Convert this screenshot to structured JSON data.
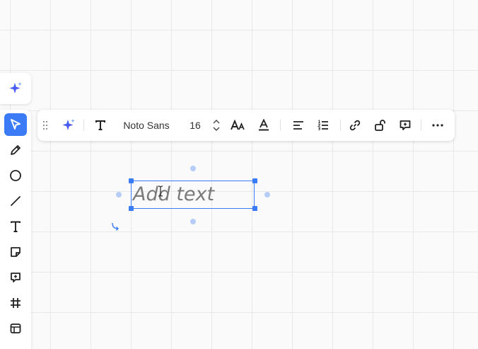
{
  "colors": {
    "accent": "#3b7cf6",
    "connector": "#b5cdf7",
    "canvas": "#fafafa",
    "grid": "#e8e8e8"
  },
  "ai_button": {
    "icon": "sparkle-icon"
  },
  "left_toolbar": {
    "tools": [
      {
        "name": "select",
        "icon": "cursor-icon",
        "active": true
      },
      {
        "name": "pen",
        "icon": "pen-icon"
      },
      {
        "name": "shape",
        "icon": "circle-icon"
      },
      {
        "name": "line",
        "icon": "line-icon"
      },
      {
        "name": "text",
        "icon": "text-icon"
      },
      {
        "name": "sticky-note",
        "icon": "sticky-note-icon"
      },
      {
        "name": "comment",
        "icon": "comment-icon"
      },
      {
        "name": "frame",
        "icon": "frame-icon"
      },
      {
        "name": "template",
        "icon": "template-icon"
      }
    ]
  },
  "context_toolbar": {
    "font_family": "Noto Sans",
    "font_size": "16",
    "items": [
      "drag-handle-icon",
      "sparkle-icon",
      "text-style-icon",
      "font-size-toggle-icon",
      "text-color-icon",
      "align-left-icon",
      "list-icon",
      "link-icon",
      "lock-icon",
      "add-comment-icon",
      "more-icon"
    ]
  },
  "canvas": {
    "text_box": {
      "placeholder": "Add text"
    }
  }
}
